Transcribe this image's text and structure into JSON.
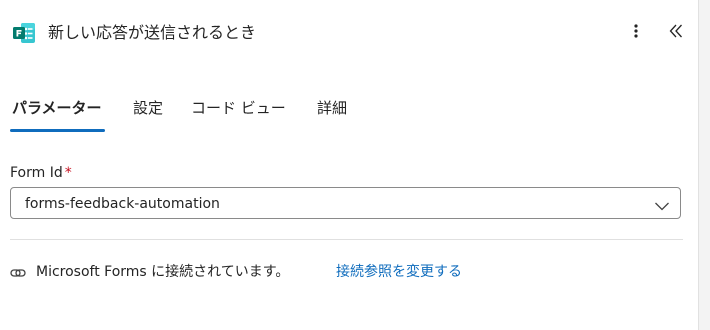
{
  "header": {
    "title": "新しい応答が送信されるとき",
    "app_icon": "microsoft-forms-icon",
    "more_icon": "more-vertical-icon",
    "collapse_icon": "double-chevron-left-icon"
  },
  "tabs": [
    {
      "label": "パラメーター",
      "active": true
    },
    {
      "label": "設定",
      "active": false
    },
    {
      "label": "コード ビュー",
      "active": false
    },
    {
      "label": "詳細",
      "active": false
    }
  ],
  "form": {
    "label": "Form Id",
    "required_mark": "*",
    "value": "forms-feedback-automation"
  },
  "connection": {
    "icon": "link-icon",
    "text": "Microsoft Forms に接続されています。",
    "change_link": "接続参照を変更する"
  },
  "colors": {
    "accent": "#0f6cbd",
    "forms_green": "#037c6e",
    "required": "#c50f1f"
  }
}
